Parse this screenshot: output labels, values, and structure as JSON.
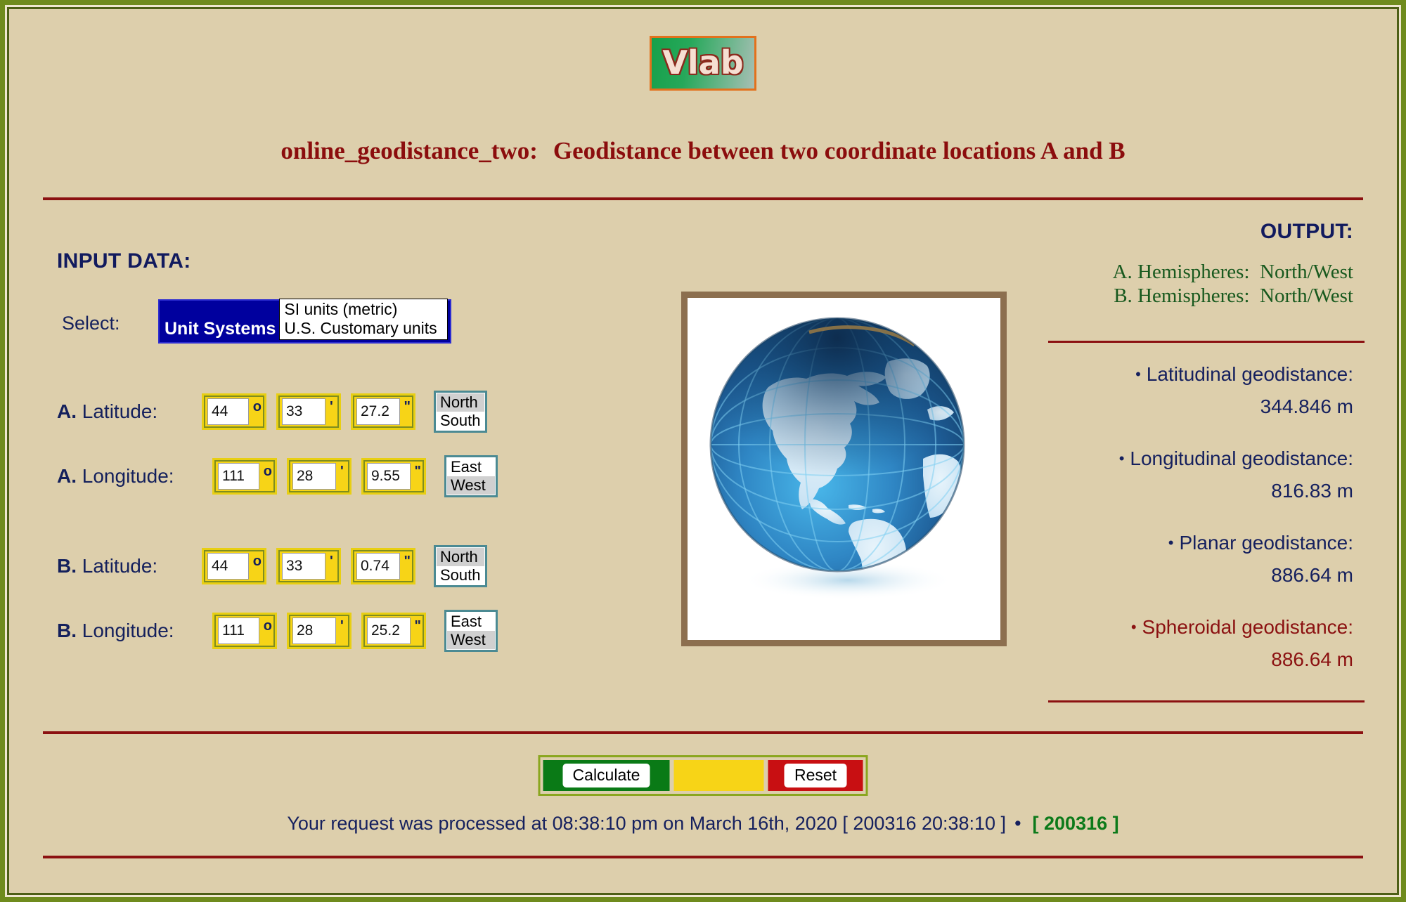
{
  "logo": {
    "text": "Vlab"
  },
  "title": {
    "program": "online_geodistance_two:",
    "description": "Geodistance between two coordinate locations A and B"
  },
  "input": {
    "heading": "INPUT DATA:",
    "select_label": "Select:",
    "unit_systems": {
      "panel_label": "Unit Systems",
      "options": [
        "SI units (metric)",
        "U.S. Customary units"
      ]
    },
    "rows": [
      {
        "label_prefix": "A.",
        "label_text": " Latitude:",
        "degrees": "44",
        "minutes": "33",
        "seconds": "27.2",
        "deg_symbol": "o",
        "min_symbol": "'",
        "sec_symbol": "\"",
        "hemi_options": [
          "North",
          "South"
        ],
        "hemi_selected": "North"
      },
      {
        "label_prefix": "A.",
        "label_text": " Longitude:",
        "degrees": "111",
        "minutes": "28",
        "seconds": "9.55",
        "deg_symbol": "o",
        "min_symbol": "'",
        "sec_symbol": "\"",
        "hemi_options": [
          "East",
          "West"
        ],
        "hemi_selected": "West"
      },
      {
        "label_prefix": "B.",
        "label_text": " Latitude:",
        "degrees": "44",
        "minutes": "33",
        "seconds": "0.74",
        "deg_symbol": "o",
        "min_symbol": "'",
        "sec_symbol": "\"",
        "hemi_options": [
          "North",
          "South"
        ],
        "hemi_selected": "North"
      },
      {
        "label_prefix": "B.",
        "label_text": " Longitude:",
        "degrees": "111",
        "minutes": "28",
        "seconds": "25.2",
        "deg_symbol": "o",
        "min_symbol": "'",
        "sec_symbol": "\"",
        "hemi_options": [
          "East",
          "West"
        ],
        "hemi_selected": "West"
      }
    ]
  },
  "output": {
    "heading": "OUTPUT:",
    "hemispheres": [
      {
        "label": "A. Hemispheres:",
        "value": "North/West"
      },
      {
        "label": "B. Hemispheres:",
        "value": "North/West"
      }
    ],
    "results": [
      {
        "bullet": "•",
        "label": "Latitudinal geodistance:",
        "value": "344.846 m",
        "accent": false
      },
      {
        "bullet": "•",
        "label": "Longitudinal geodistance:",
        "value": "816.83 m",
        "accent": false
      },
      {
        "bullet": "•",
        "label": "Planar geodistance:",
        "value": "886.64 m",
        "accent": false
      },
      {
        "bullet": "•",
        "label": "Spheroidal geodistance:",
        "value": "886.64 m",
        "accent": true
      }
    ]
  },
  "buttons": {
    "calculate": "Calculate",
    "reset": "Reset"
  },
  "footer": {
    "message": "Your request was processed at  08:38:10 pm on March 16th, 2020   [ 200316  20:38:10 ]",
    "separator": "•",
    "tag": "[ 200316 ]"
  },
  "image": {
    "alt": "globe-earth-americas"
  },
  "colors": {
    "page_background": "#ddcfac",
    "outer_border": "#6f8b1d",
    "rule": "#8b1111",
    "title": "#8b0d0d",
    "navy": "#15205e",
    "green_text": "#18591e",
    "accent_red": "#8b1111",
    "input_yellow": "#f7d417",
    "select_blue": "#00009e"
  }
}
